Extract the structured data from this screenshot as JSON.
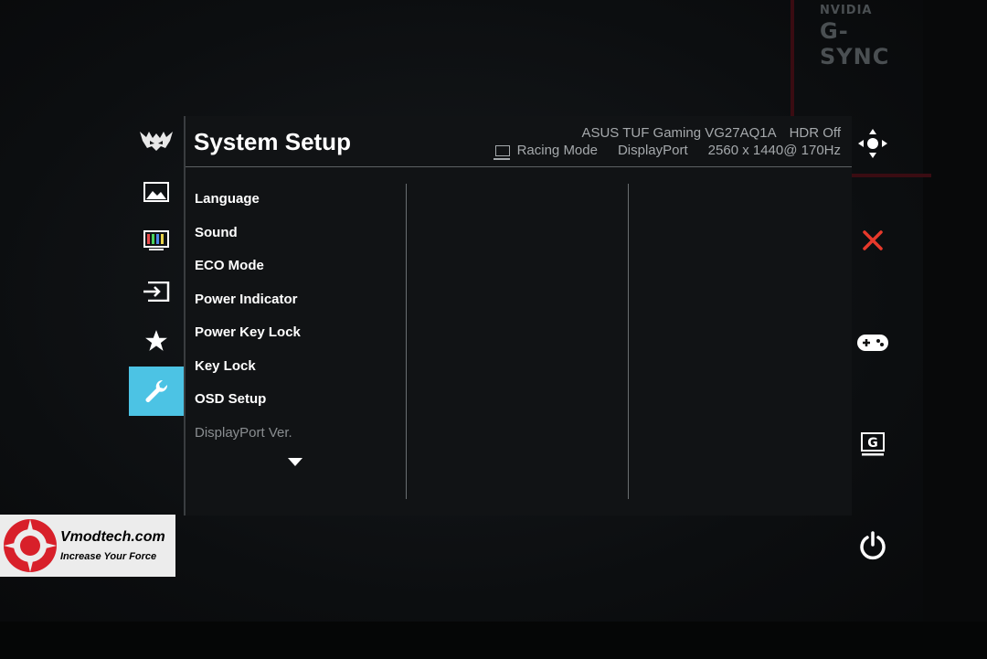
{
  "osd": {
    "title": "System Setup",
    "model": "ASUS TUF Gaming VG27AQ1A",
    "hdr": "HDR Off",
    "mode": "Racing Mode",
    "input": "DisplayPort",
    "resolution": "2560 x 1440@ 170Hz",
    "menu_items": [
      "Language",
      "Sound",
      "ECO Mode",
      "Power Indicator",
      "Power Key Lock",
      "Key Lock",
      "OSD Setup",
      "DisplayPort Ver."
    ],
    "accent_color": "#4cc3e4",
    "close_color": "#e8392b"
  },
  "nav": {
    "items": [
      "tuf-logo-icon",
      "image-icon",
      "color-icon",
      "input-select-icon",
      "favorite-star-icon",
      "wrench-icon"
    ],
    "active": "wrench-icon"
  },
  "controls": [
    "five-way-joystick-icon",
    "close-icon",
    "gameplus-icon",
    "gamevisual-icon",
    "power-icon"
  ],
  "branding": {
    "nvidia": "NVIDIA",
    "gsync": "G-SYNC"
  },
  "watermark": {
    "site": "Vmodtech.com",
    "slogan": "Increase Your Force"
  }
}
